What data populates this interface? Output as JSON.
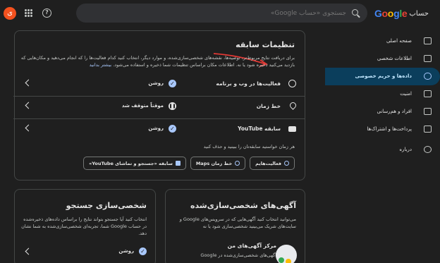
{
  "header": {
    "avatar_letter": "ی",
    "search_placeholder": "جستجوی «حساب Google»",
    "logo_google": [
      "G",
      "o",
      "o",
      "g",
      "l",
      "e"
    ],
    "logo_suffix": "حساب"
  },
  "sidebar": {
    "items": [
      {
        "label": "صفحه اصلی",
        "icon": "home-icon",
        "active": false
      },
      {
        "label": "اطلاعات شخصی",
        "icon": "person-icon",
        "active": false
      },
      {
        "label": "داده‌ها و حریم خصوصی",
        "icon": "toggle-icon",
        "active": true
      },
      {
        "label": "امنیت",
        "icon": "lock-icon",
        "active": false
      },
      {
        "label": "افراد و هم‌رسانی",
        "icon": "people-icon",
        "active": false
      },
      {
        "label": "پرداخت‌ها و اشتراک‌ها",
        "icon": "card-icon",
        "active": false
      },
      {
        "label": "درباره",
        "icon": "info-icon",
        "active": false
      }
    ]
  },
  "history": {
    "title": "تنظیمات سابقه",
    "desc": "برای دریافت نتایج مربوط‌تر، توصیه‌ها، نقشه‌های شخصی‌سازی‌شده، و موارد دیگر، انتخاب کنید کدام فعالیت‌ها را که انجام می‌دهید و مکان‌هایی که بازدید می‌کنید ذخیره شود یا نه. اطلاعات مکان براساس تنظیمات شما ذخیره و استفاده می‌شود.",
    "learn_more": "بیشتر بدانید",
    "rows": [
      {
        "label": "فعالیت‌ها در وب و برنامه",
        "status": "روشن",
        "icon": "history-icon",
        "status_icon": "check-icon"
      },
      {
        "label": "خط زمان",
        "status": "موقتاً متوقف شد",
        "icon": "location-pin-icon",
        "status_icon": "pause-icon"
      },
      {
        "label": "سابقه YouTube",
        "status": "روشن",
        "icon": "youtube-icon",
        "status_icon": "check-icon"
      }
    ],
    "manage_text": "هر زمان خواستید سابقه‌تان را ببینید و حذف کنید",
    "chips": [
      {
        "label": "فعالیت‌هایم",
        "icon": "history-icon"
      },
      {
        "label": "خط زمان Maps",
        "icon": "location-pin-icon"
      },
      {
        "label": "سابقه «جستجو و تماشای YouTube»",
        "icon": "youtube-icon"
      }
    ]
  },
  "ads": {
    "title": "آگهی‌های شخصی‌سازی‌شده",
    "desc": "می‌توانید انتخاب کنید آگهی‌هایی که در سرویس‌های Google و سایت‌های شریک می‌بینید شخصی‌سازی شود یا نه",
    "center_title": "مرکز آگهی‌های من",
    "center_desc": "آگهی‌های شخصی‌سازی‌شده در Google"
  },
  "search_personal": {
    "title": "شخصی‌سازی جستجو",
    "desc": "انتخاب کنید آیا جستجو بتواند نتایج را براساس داده‌های ذخیره‌شده در حساب Google شما، تجربه‌ای شخصی‌سازی‌شده به شما نشان دهد.",
    "status": "روشن"
  },
  "colors": {
    "background": "#1f1f1f",
    "active_nav": "#0b3e5c",
    "accent": "#a8c7fa",
    "annotation_arrow": "#e53935"
  }
}
